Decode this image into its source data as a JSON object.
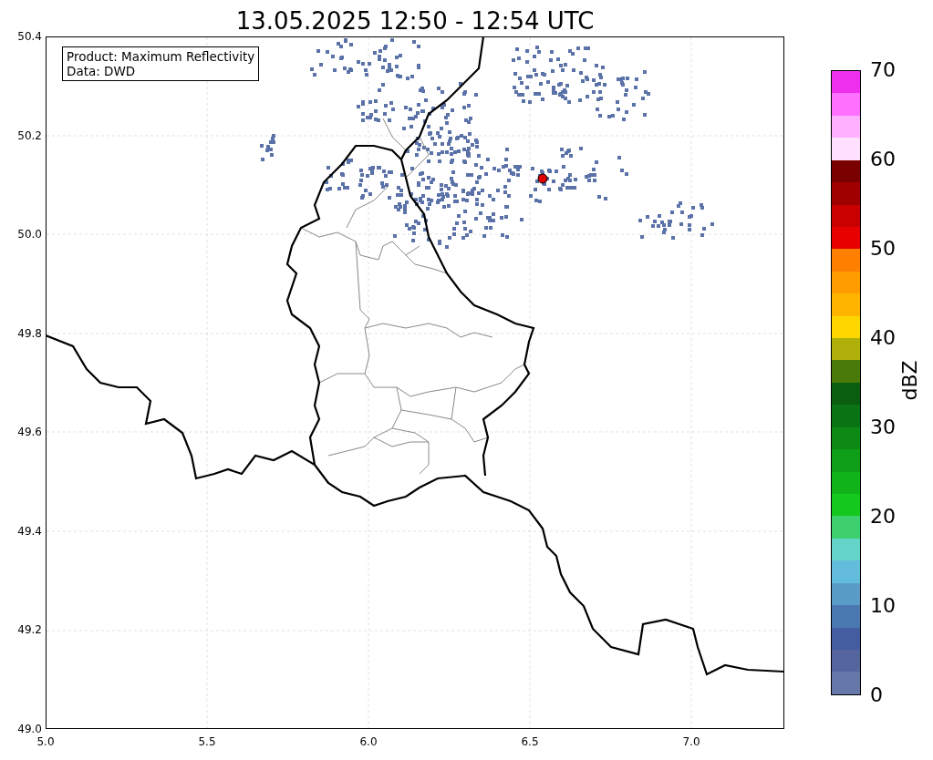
{
  "title": "13.05.2025 12:50 - 12:54 UTC",
  "info_box": {
    "lines": [
      "Product: Maximum Reflectivity",
      "Data: DWD"
    ]
  },
  "map": {
    "yticks": [
      "50.4",
      "50.2",
      "50.0",
      "49.8",
      "49.6",
      "49.4",
      "49.2",
      "49.0"
    ],
    "xticks": [
      "5.0",
      "5.5",
      "6.0",
      "6.5",
      "7.0"
    ]
  },
  "colorbar": {
    "label": "dBZ",
    "ticks": [
      "70",
      "60",
      "50",
      "40",
      "30",
      "20",
      "10",
      "0"
    ],
    "segments": [
      {
        "color": "#ee30ee"
      },
      {
        "color": "#ff70ff"
      },
      {
        "color": "#ffb0ff"
      },
      {
        "color": "#ffe0ff"
      },
      {
        "color": "#7a0000"
      },
      {
        "color": "#a00000"
      },
      {
        "color": "#c80000"
      },
      {
        "color": "#e60000"
      },
      {
        "color": "#ff7f00"
      },
      {
        "color": "#ff9c00"
      },
      {
        "color": "#ffb400"
      },
      {
        "color": "#ffd700"
      },
      {
        "color": "#b0b00a"
      },
      {
        "color": "#4a7a0a"
      },
      {
        "color": "#0a5e10"
      },
      {
        "color": "#0a7414"
      },
      {
        "color": "#0c8a14"
      },
      {
        "color": "#0e9e18"
      },
      {
        "color": "#10b41a"
      },
      {
        "color": "#14c81e"
      },
      {
        "color": "#3ecf6e"
      },
      {
        "color": "#64d4c8"
      },
      {
        "color": "#64bcdc"
      },
      {
        "color": "#5a9cc8"
      },
      {
        "color": "#4a78b0"
      },
      {
        "color": "#445da0"
      },
      {
        "color": "#55669f"
      },
      {
        "color": "#6677aa"
      }
    ]
  }
}
